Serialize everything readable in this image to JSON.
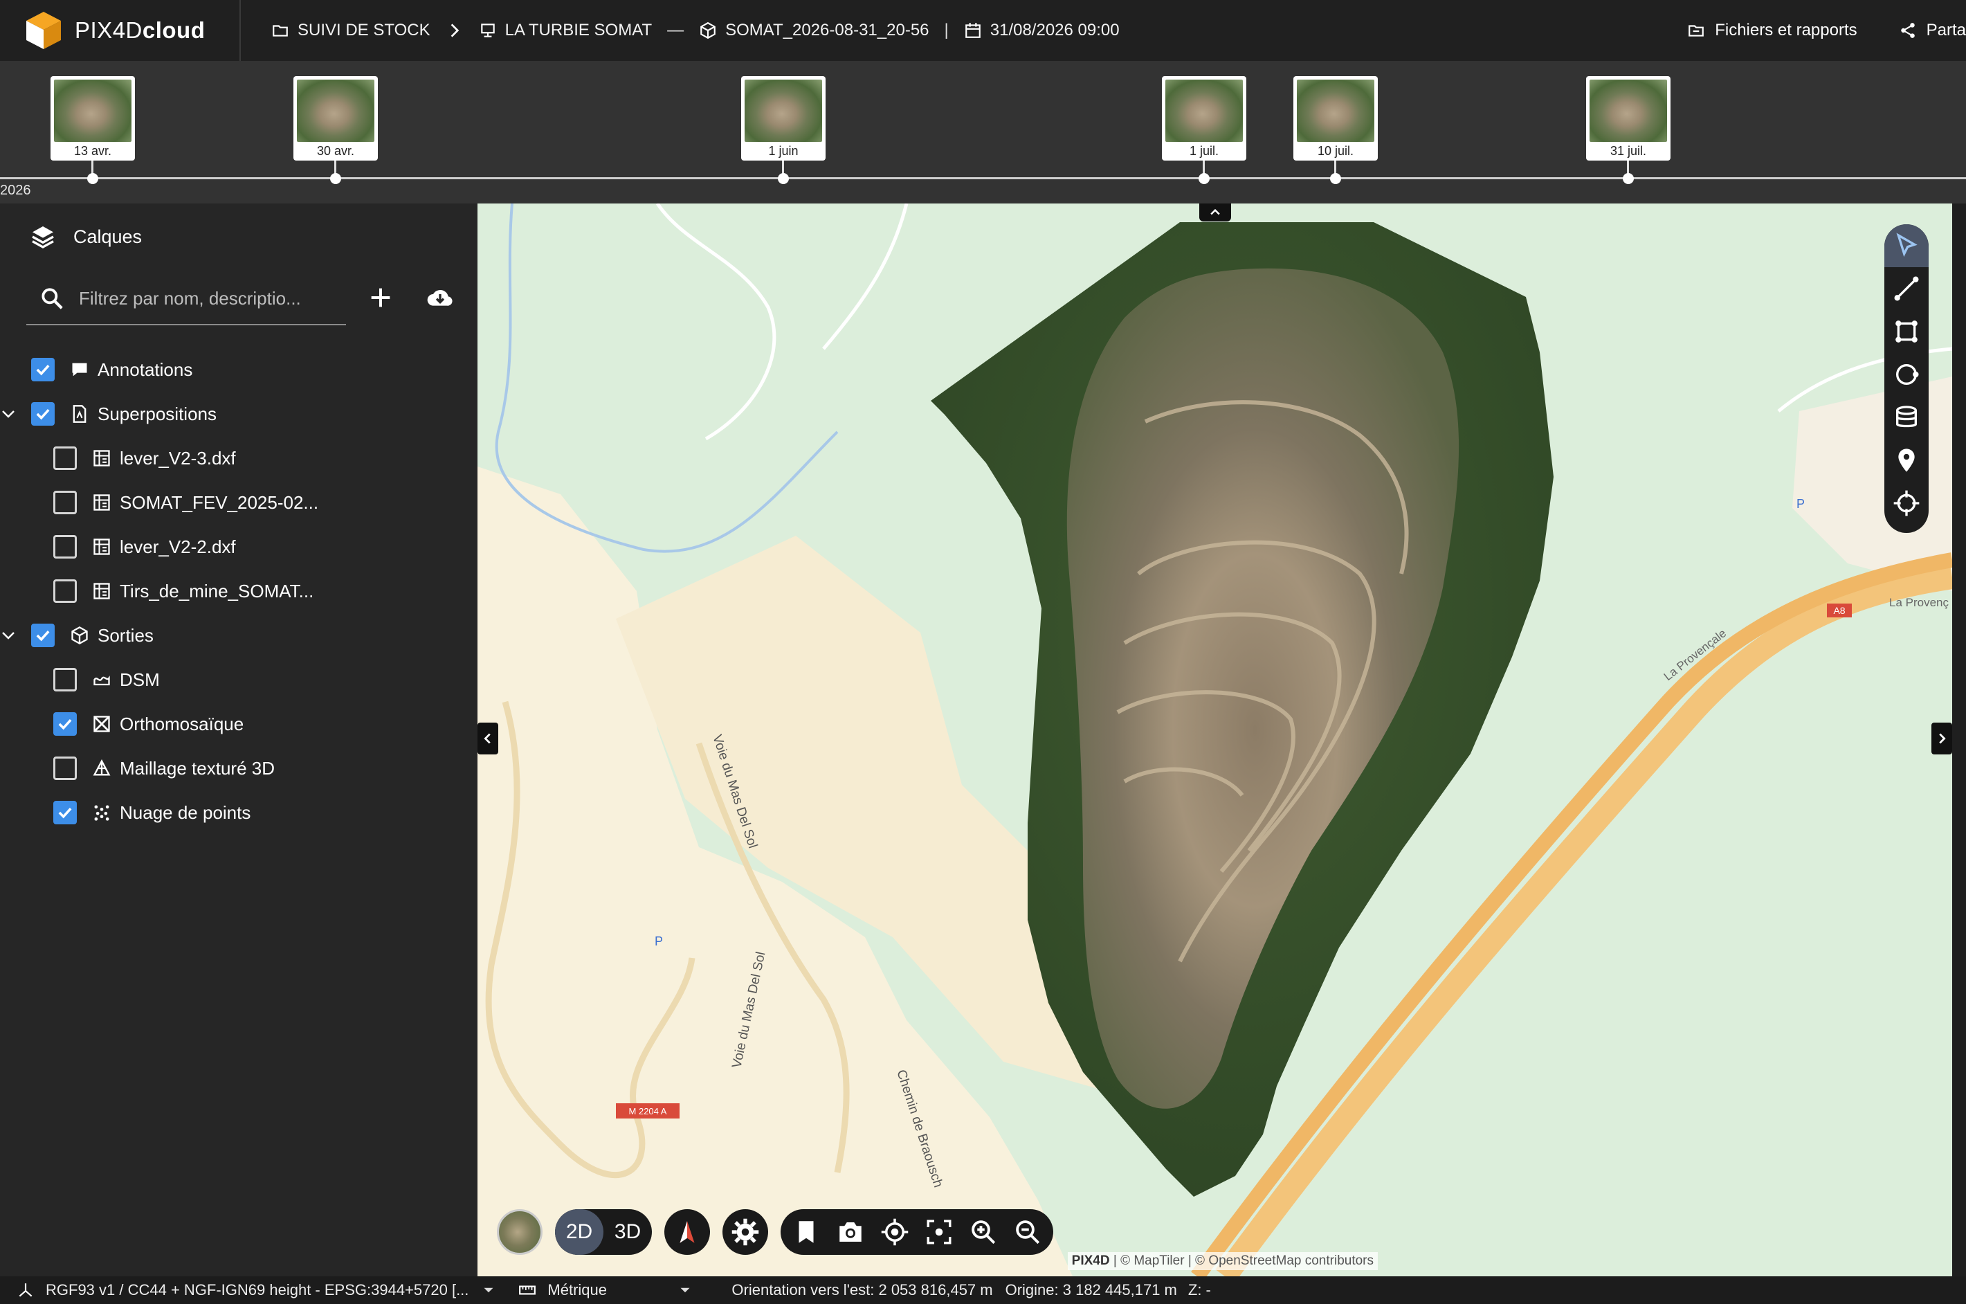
{
  "app": {
    "brand_light": "PIX4D",
    "brand_bold": "cloud"
  },
  "breadcrumb": {
    "project_group": "SUIVI DE STOCK",
    "site": "LA TURBIE SOMAT",
    "dataset": "SOMAT_2026-08-31_20-56",
    "date": "31/08/2026 09:00"
  },
  "top_right": {
    "files_reports": "Fichiers et rapports",
    "share": "Parta"
  },
  "timeline": {
    "year": "2026",
    "items": [
      {
        "label": "13 avr."
      },
      {
        "label": "30 avr."
      },
      {
        "label": "1 juin"
      },
      {
        "label": "1 juil."
      },
      {
        "label": "10 juil."
      },
      {
        "label": "31 juil."
      }
    ]
  },
  "layers_panel": {
    "title": "Calques",
    "filter_placeholder": "Filtrez par nom, descriptio...",
    "items": [
      {
        "label": "Annotations",
        "checked": true
      },
      {
        "label": "Superpositions",
        "checked": true
      },
      {
        "label": "lever_V2-3.dxf",
        "checked": false
      },
      {
        "label": "SOMAT_FEV_2025-02...",
        "checked": false
      },
      {
        "label": "lever_V2-2.dxf",
        "checked": false
      },
      {
        "label": "Tirs_de_mine_SOMAT...",
        "checked": false
      },
      {
        "label": "Sorties",
        "checked": true
      },
      {
        "label": "DSM",
        "checked": false
      },
      {
        "label": "Orthomosaïque",
        "checked": true
      },
      {
        "label": "Maillage texturé 3D",
        "checked": false
      },
      {
        "label": "Nuage de points",
        "checked": true
      }
    ]
  },
  "map": {
    "view_2d": "2D",
    "view_3d": "3D",
    "labels": {
      "road1": "Voie du Mas Del Sol",
      "road2": "Voie du Mas Del Sol",
      "road3": "Chemin de Braousch",
      "road4": "La Provençale",
      "road5": "La Provenç",
      "m_badge": "M 2204 A",
      "a_badge": "A8",
      "parking": "P"
    },
    "attribution_brand": "PIX4D",
    "attribution": " | © MapTiler | © OpenStreetMap contributors"
  },
  "status": {
    "crs": "RGF93 v1 / CC44 + NGF-IGN69 height - EPSG:3944+5720 [...",
    "units": "Métrique",
    "orientation": "Orientation vers l'est: 2 053 816,457 m",
    "origin": "Origine: 3 182 445,171 m",
    "z": "Z: -"
  },
  "colors": {
    "accent": "#3d8ee8",
    "active_tool": "#4b5568",
    "map_green": "#dfeede"
  }
}
